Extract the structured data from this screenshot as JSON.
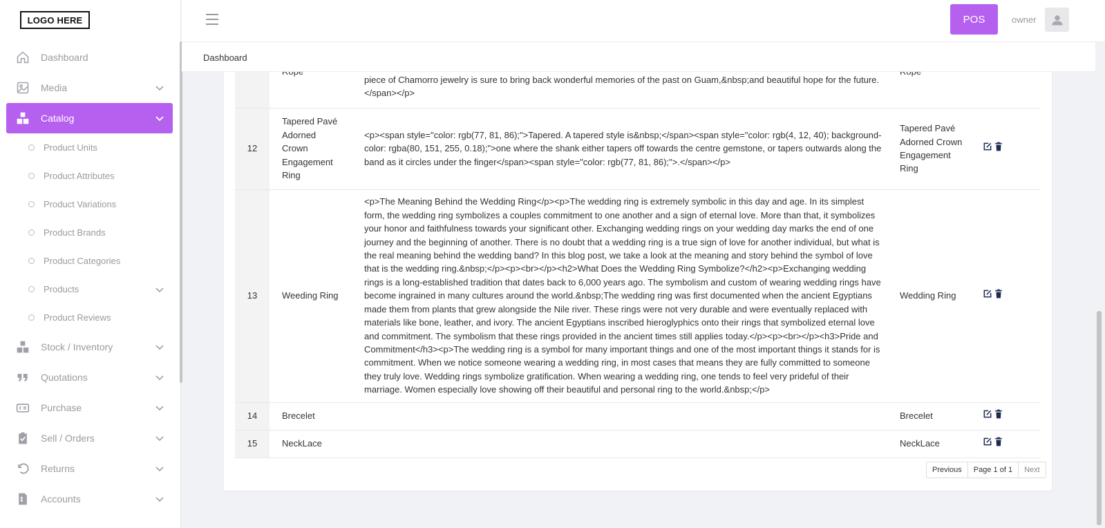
{
  "brand": {
    "logo_text": "LOGO HERE",
    "accent": "#b660f0"
  },
  "header": {
    "pos_label": "POS",
    "user_name": "owner"
  },
  "breadcrumb": "Dashboard",
  "sidebar": {
    "items": [
      {
        "label": "Dashboard",
        "icon": "home-icon"
      },
      {
        "label": "Media",
        "icon": "image-icon"
      },
      {
        "label": "Catalog",
        "icon": "boxes-icon"
      },
      {
        "label": "Stock / Inventory",
        "icon": "boxes-icon"
      },
      {
        "label": "Quotations",
        "icon": "quote-icon"
      },
      {
        "label": "Purchase",
        "icon": "money-icon"
      },
      {
        "label": "Sell / Orders",
        "icon": "clipboard-icon"
      },
      {
        "label": "Returns",
        "icon": "undo-icon"
      },
      {
        "label": "Accounts",
        "icon": "invoice-icon"
      }
    ],
    "catalog_sub": [
      "Product Units",
      "Product Attributes",
      "Product Variations",
      "Product Brands",
      "Product Categories",
      "Products",
      "Product Reviews"
    ]
  },
  "table": {
    "rows": [
      {
        "index": "",
        "name": "Rope",
        "desc": "piece of Chamorro jewelry is sure to bring back wonderful memories of the past on Guam,&nbsp;and beautiful hope for the future.</span></p>",
        "slug": "Rope"
      },
      {
        "index": "12",
        "name": "Tapered Pavé Adorned Crown Engagement Ring",
        "desc": "<p><span style=\"color: rgb(77, 81, 86);\">Tapered. A tapered style is&nbsp;</span><span style=\"color: rgb(4, 12, 40); background-color: rgba(80, 151, 255, 0.18);\">one where the shank either tapers off towards the centre gemstone, or tapers outwards along the band as it circles under the finger</span><span style=\"color: rgb(77, 81, 86);\">.</span></p>",
        "slug": "Tapered Pavé Adorned Crown Engagement Ring"
      },
      {
        "index": "13",
        "name": "Weeding Ring",
        "desc": "<p>The Meaning Behind the Wedding Ring</p><p>The wedding ring is extremely symbolic in this day and age. In its simplest form, the wedding ring symbolizes a couples commitment to one another and a sign of eternal love. More than that, it symbolizes your honor and faithfulness towards your significant other. Exchanging wedding rings on your wedding day marks the end of one journey and the beginning of another. There is no doubt that a wedding ring is a true sign of love for another individual, but what is the real meaning behind the wedding band? In this blog post, we take a look at the meaning and story behind the symbol of love that is the wedding ring.&nbsp;</p><p><br></p><h2>What Does the Wedding Ring Symbolize?</h2><p>Exchanging wedding rings is a long-established tradition that dates back to 6,000 years ago. The symbolism and custom of wearing wedding rings have become ingrained in many cultures around the world.&nbsp;The wedding ring was first documented when the ancient Egyptians made them from plants that grew alongside the Nile river. These rings were not very durable and were eventually replaced with materials like bone, leather, and ivory. The ancient Egyptians inscribed hieroglyphics onto their rings that symbolized eternal love and commitment. The symbolism that these rings provided in the ancient times still applies today.</p><p><br></p><h3>Pride and Commitment</h3><p>The wedding ring is a symbol for many important things and one of the most important things it stands for is commitment. When we notice someone wearing a wedding ring, in most cases that means they are fully committed to someone they truly love. Wedding rings symbolize gratification. When wearing a wedding ring, one tends to feel very prideful of their marriage. Women especially love showing off their beautiful and personal ring to the world.&nbsp;</p>",
        "slug": "Wedding Ring"
      },
      {
        "index": "14",
        "name": "Brecelet",
        "desc": "",
        "slug": "Brecelet"
      },
      {
        "index": "15",
        "name": "NeckLace",
        "desc": "",
        "slug": "NeckLace"
      }
    ]
  },
  "pagination": {
    "prev": "Previous",
    "page": "Page 1 of 1",
    "next": "Next"
  }
}
